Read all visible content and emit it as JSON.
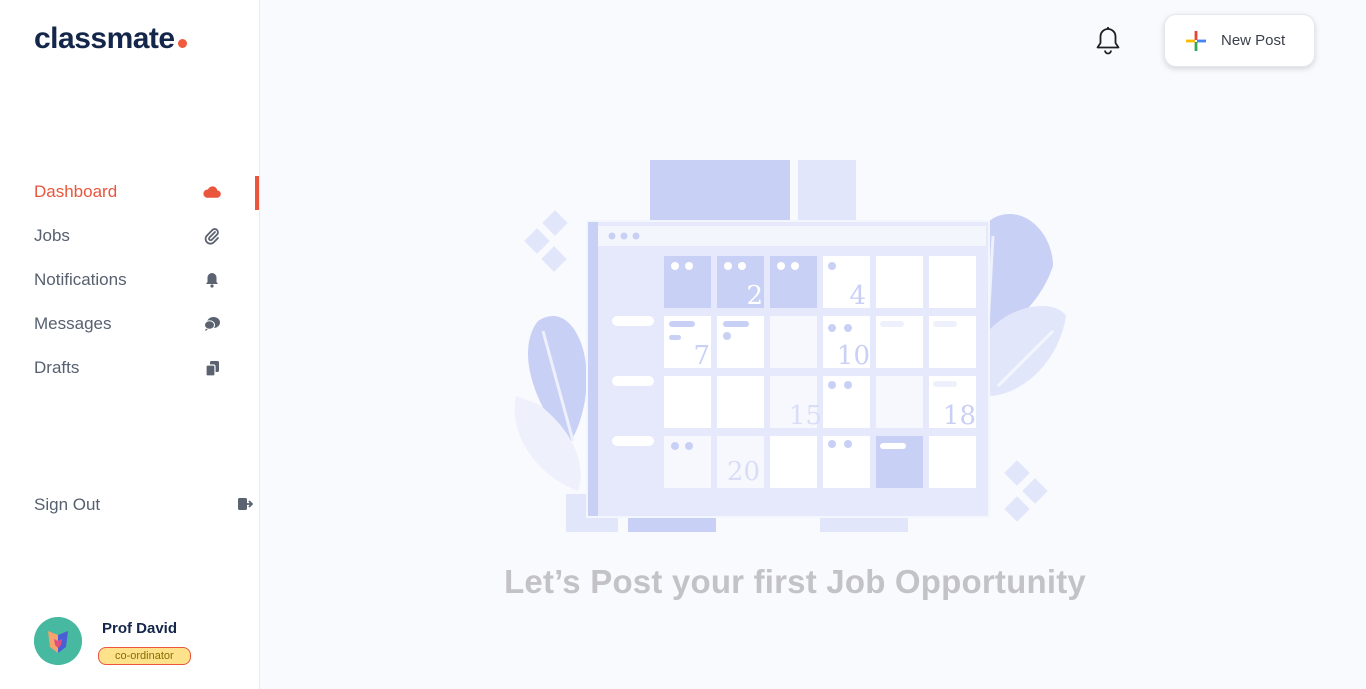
{
  "app": {
    "logo_text": "classmate"
  },
  "sidebar": {
    "items": [
      {
        "label": "Dashboard",
        "icon": "cloud-icon",
        "active": true
      },
      {
        "label": "Jobs",
        "icon": "paperclip-icon",
        "active": false
      },
      {
        "label": "Notifications",
        "icon": "bell-icon",
        "active": false
      },
      {
        "label": "Messages",
        "icon": "chat-icon",
        "active": false
      },
      {
        "label": "Drafts",
        "icon": "copy-icon",
        "active": false
      }
    ],
    "signout_label": "Sign Out"
  },
  "profile": {
    "name": "Prof David",
    "role": "co-ordinator"
  },
  "header": {
    "new_post_label": "New Post"
  },
  "main": {
    "empty_title": "Let’s Post your first Job Opportunity",
    "calendar_numbers": [
      "2",
      "4",
      "7",
      "10",
      "15",
      "18",
      "20"
    ]
  },
  "colors": {
    "accent": "#e9553d",
    "navy": "#14264a",
    "illustration": "#c9d0f5"
  }
}
